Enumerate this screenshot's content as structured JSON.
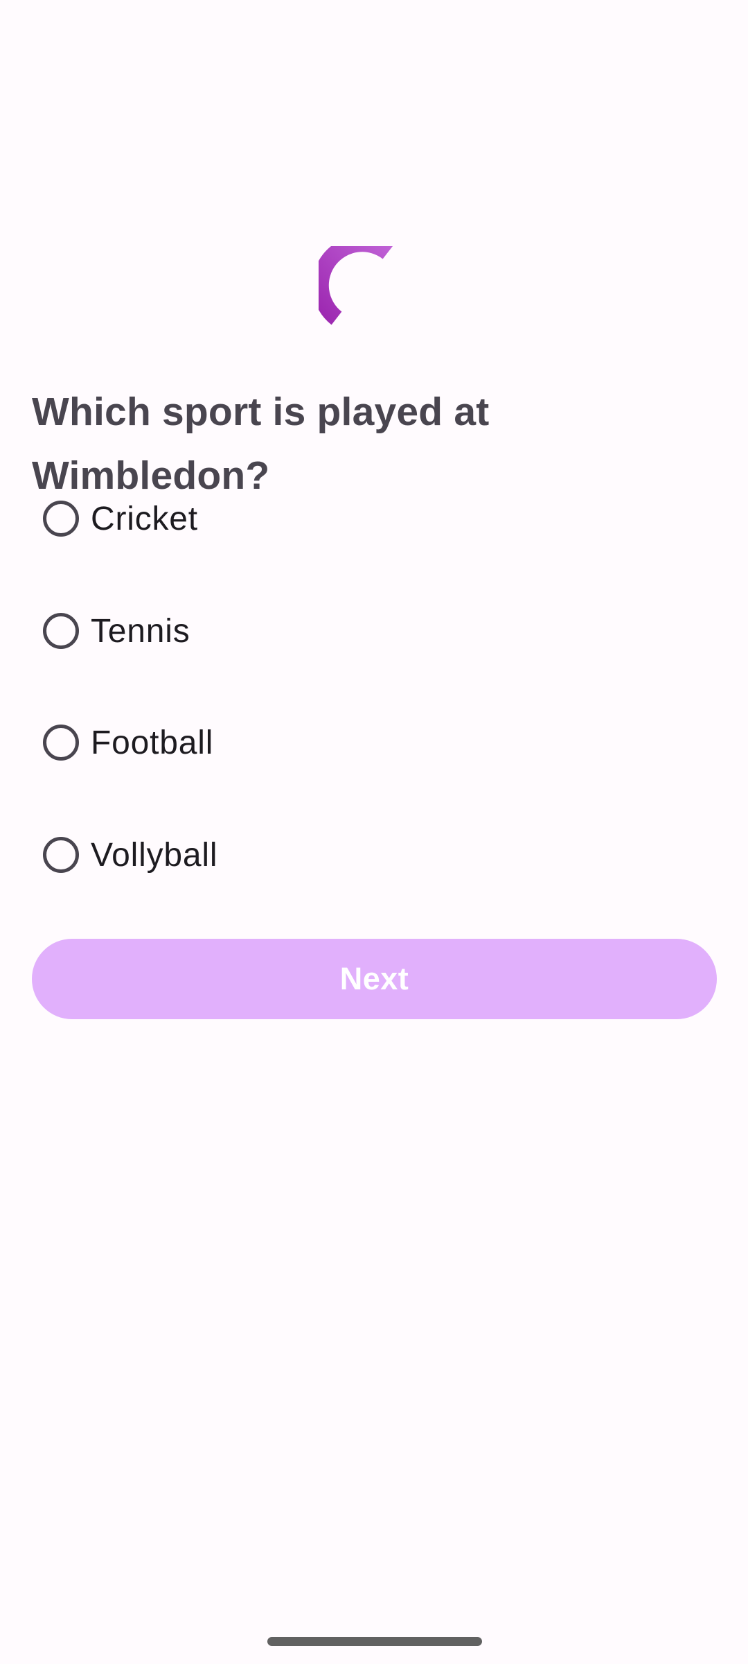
{
  "quiz": {
    "question": "Which sport is played at Wimbledon?",
    "options": [
      {
        "label": "Cricket",
        "selected": false
      },
      {
        "label": "Tennis",
        "selected": false
      },
      {
        "label": "Football",
        "selected": false
      },
      {
        "label": "Vollyball",
        "selected": false
      }
    ],
    "next_label": "Next",
    "next_enabled": false
  },
  "loading": {
    "icon": "loading-spinner-icon",
    "visible": true
  },
  "colors": {
    "accent": "#9c27b0",
    "accent_light": "#c061d6",
    "button_disabled_bg": "#e1b0fc",
    "button_text": "#ffffff",
    "question_text": "#49454f",
    "option_text": "#1d1b20",
    "radio_outline": "#49454f",
    "background": "#fffbfe",
    "home_indicator": "#616161"
  }
}
